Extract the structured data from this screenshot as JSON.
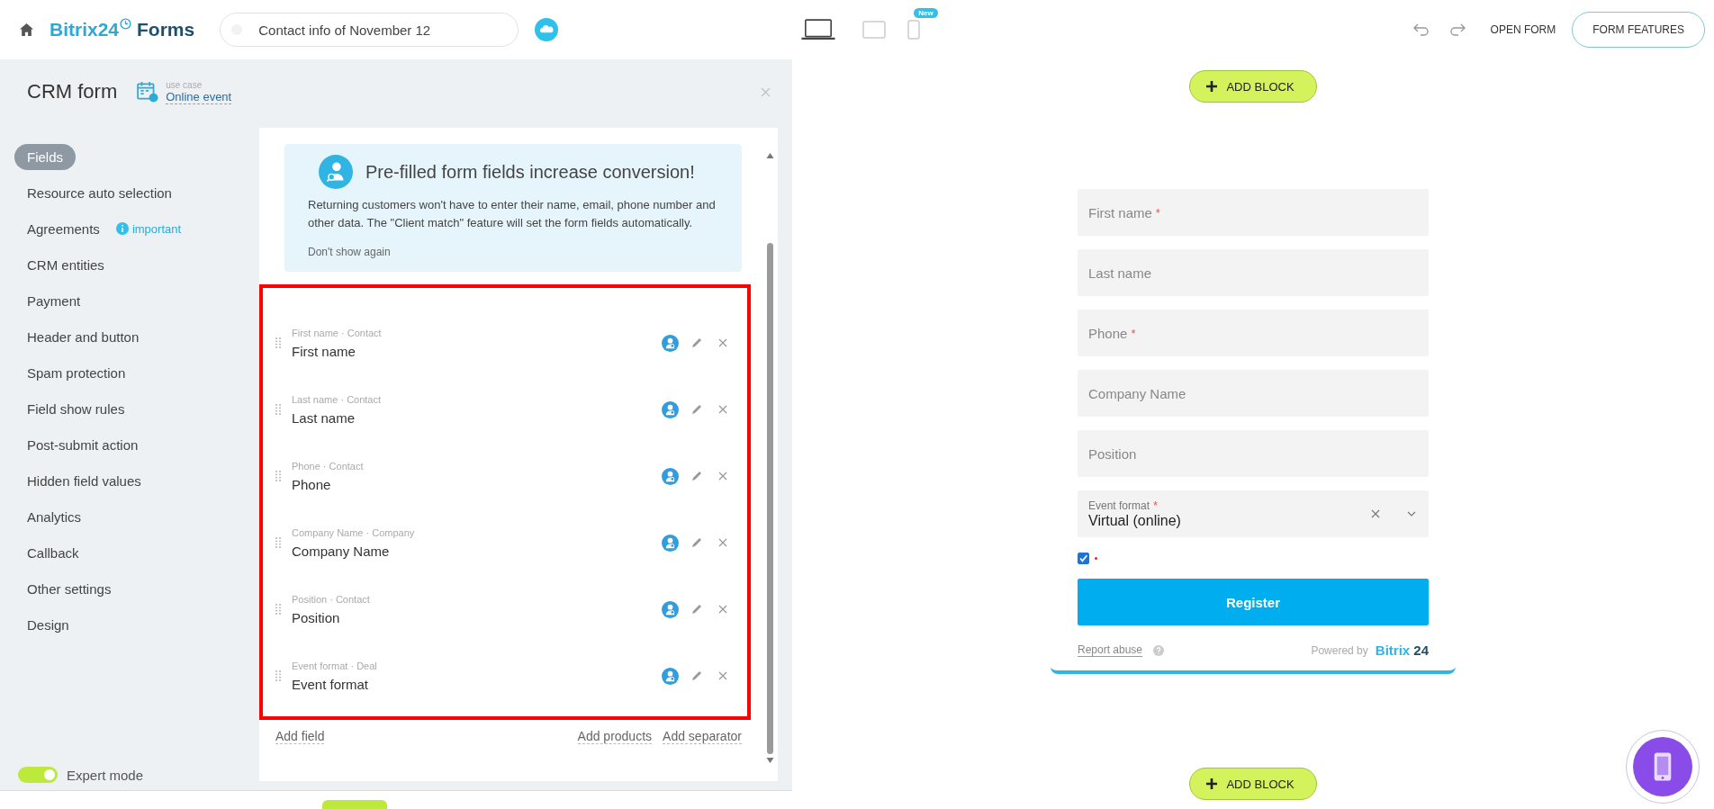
{
  "top_bar": {
    "logo_brand": "Bitrix24",
    "logo_product": "Forms",
    "form_name": "Contact info of November 12",
    "devices": [
      {
        "kind": "laptop",
        "selected": true
      },
      {
        "kind": "tablet",
        "selected": false
      },
      {
        "kind": "phone",
        "selected": false,
        "badge": "New"
      }
    ],
    "open_link": "OPEN FORM",
    "features_button": "FORM FEATURES"
  },
  "panel": {
    "title": "CRM form",
    "use_case_label": "use case",
    "use_case": "Online event"
  },
  "nav": [
    {
      "label": "Fields",
      "selected": true
    },
    {
      "label": "Resource auto selection",
      "selected": false
    },
    {
      "label": "Agreements",
      "selected": false,
      "badge": "important"
    },
    {
      "label": "CRM entities",
      "selected": false
    },
    {
      "label": "Payment",
      "selected": false
    },
    {
      "label": "Header and button",
      "selected": false
    },
    {
      "label": "Spam protection",
      "selected": false
    },
    {
      "label": "Field show rules",
      "selected": false
    },
    {
      "label": "Post-submit action",
      "selected": false
    },
    {
      "label": "Hidden field values",
      "selected": false
    },
    {
      "label": "Analytics",
      "selected": false
    },
    {
      "label": "Callback",
      "selected": false
    },
    {
      "label": "Other settings",
      "selected": false
    },
    {
      "label": "Design",
      "selected": false
    }
  ],
  "expert_mode": {
    "label": "Expert mode",
    "on": true
  },
  "promo": {
    "title": "Pre-filled form fields increase conversion!",
    "text": "Returning customers won't have to enter their name, email, phone number and other data. The \"Client match\" feature will set the form fields automatically.",
    "dismiss": "Don't show again"
  },
  "fields": [
    {
      "caption": "First name · Contact",
      "name": "First name"
    },
    {
      "caption": "Last name · Contact",
      "name": "Last name"
    },
    {
      "caption": "Phone · Contact",
      "name": "Phone"
    },
    {
      "caption": "Company Name · Company",
      "name": "Company Name"
    },
    {
      "caption": "Position · Contact",
      "name": "Position"
    },
    {
      "caption": "Event format · Deal",
      "name": "Event format"
    }
  ],
  "add_field_link": "Add field",
  "extra_actions": [
    "Add products",
    "Add separator"
  ],
  "preview": {
    "add_block_buttons": [
      "ADD BLOCK",
      "ADD BLOCK"
    ],
    "required_mark": "*",
    "inputs": [
      {
        "kind": "text",
        "placeholder": "First name",
        "required": true
      },
      {
        "kind": "text",
        "placeholder": "Last name",
        "required": false
      },
      {
        "kind": "text",
        "placeholder": "Phone",
        "required": true
      },
      {
        "kind": "text",
        "placeholder": "Company Name",
        "required": false
      },
      {
        "kind": "text",
        "placeholder": "Position",
        "required": false
      },
      {
        "kind": "select",
        "label": "Event format",
        "required": true,
        "value": "Virtual (online)"
      }
    ],
    "agreement": {
      "checked": true,
      "required": true
    },
    "submit": "Register",
    "report_link": "Report abuse",
    "powered_by": "Powered by",
    "brand_name": "Bitrix",
    "brand_number": "24"
  }
}
